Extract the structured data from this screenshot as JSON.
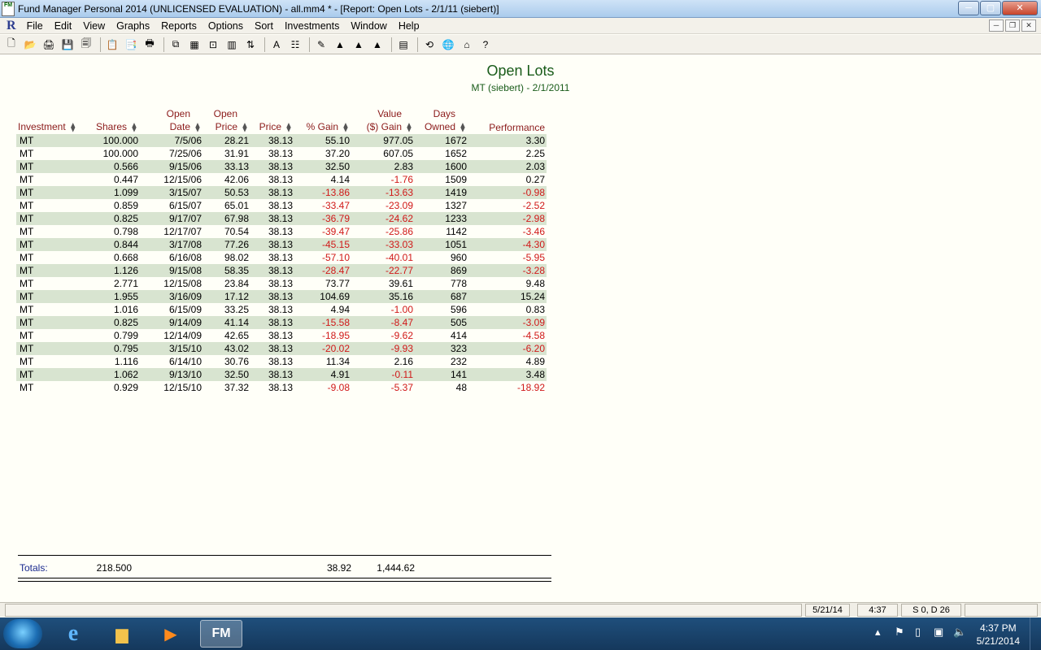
{
  "window": {
    "title": "Fund Manager Personal 2014 (UNLICENSED EVALUATION) - all.mm4 * - [Report: Open Lots - 2/1/11 (siebert)]",
    "app_icon_text": "FM",
    "minimize": "─",
    "maximize": "▢",
    "close": "✕"
  },
  "menubar": {
    "logo": "R",
    "items": [
      "File",
      "Edit",
      "View",
      "Graphs",
      "Reports",
      "Options",
      "Sort",
      "Investments",
      "Window",
      "Help"
    ],
    "mdi_min": "─",
    "mdi_restore": "❐",
    "mdi_close": "✕"
  },
  "toolbar": {
    "buttons": [
      {
        "name": "new-icon",
        "glyph": "🗋"
      },
      {
        "name": "open-icon",
        "glyph": "📂"
      },
      {
        "name": "print-setup-icon",
        "glyph": "🖨"
      },
      {
        "name": "save-icon",
        "glyph": "💾"
      },
      {
        "name": "save-all-icon",
        "glyph": "🗐"
      },
      {
        "name": "import-icon",
        "glyph": "📋"
      },
      {
        "name": "export-icon",
        "glyph": "📑"
      },
      {
        "name": "print-icon",
        "glyph": "🖶"
      },
      {
        "name": "copy-icon",
        "glyph": "⧉"
      },
      {
        "name": "report-icon",
        "glyph": "▦"
      },
      {
        "name": "zoom-icon",
        "glyph": "⊡"
      },
      {
        "name": "columns-icon",
        "glyph": "▥"
      },
      {
        "name": "sort-icon",
        "glyph": "⇅"
      },
      {
        "name": "font-icon",
        "glyph": "A"
      },
      {
        "name": "select-columns-icon",
        "glyph": "☷"
      },
      {
        "name": "edit-icon",
        "glyph": "✎"
      },
      {
        "name": "prices-icon",
        "glyph": "▲"
      },
      {
        "name": "history-icon",
        "glyph": "▲"
      },
      {
        "name": "transactions-icon",
        "glyph": "▲"
      },
      {
        "name": "calculator-icon",
        "glyph": "▤"
      },
      {
        "name": "refresh-icon",
        "glyph": "⟲"
      },
      {
        "name": "web-icon",
        "glyph": "🌐"
      },
      {
        "name": "home-icon",
        "glyph": "⌂"
      },
      {
        "name": "help-icon",
        "glyph": "?"
      }
    ]
  },
  "report": {
    "title": "Open Lots",
    "subtitle": "MT (siebert) - 2/1/2011",
    "sorter_glyph": "⧫",
    "columns": [
      {
        "line1": "",
        "line2": "Investment"
      },
      {
        "line1": "",
        "line2": "Shares"
      },
      {
        "line1": "Open",
        "line2": "Date"
      },
      {
        "line1": "Open",
        "line2": "Price"
      },
      {
        "line1": "",
        "line2": "Price"
      },
      {
        "line1": "",
        "line2": "% Gain"
      },
      {
        "line1": "Value",
        "line2": "($) Gain"
      },
      {
        "line1": "Days",
        "line2": "Owned"
      },
      {
        "line1": "",
        "line2": "Performance"
      }
    ],
    "rows": [
      [
        "MT",
        "100.000",
        "7/5/06",
        "28.21",
        "38.13",
        "55.10",
        "977.05",
        "1672",
        "3.30"
      ],
      [
        "MT",
        "100.000",
        "7/25/06",
        "31.91",
        "38.13",
        "37.20",
        "607.05",
        "1652",
        "2.25"
      ],
      [
        "MT",
        "0.566",
        "9/15/06",
        "33.13",
        "38.13",
        "32.50",
        "2.83",
        "1600",
        "2.03"
      ],
      [
        "MT",
        "0.447",
        "12/15/06",
        "42.06",
        "38.13",
        "4.14",
        "-1.76",
        "1509",
        "0.27"
      ],
      [
        "MT",
        "1.099",
        "3/15/07",
        "50.53",
        "38.13",
        "-13.86",
        "-13.63",
        "1419",
        "-0.98"
      ],
      [
        "MT",
        "0.859",
        "6/15/07",
        "65.01",
        "38.13",
        "-33.47",
        "-23.09",
        "1327",
        "-2.52"
      ],
      [
        "MT",
        "0.825",
        "9/17/07",
        "67.98",
        "38.13",
        "-36.79",
        "-24.62",
        "1233",
        "-2.98"
      ],
      [
        "MT",
        "0.798",
        "12/17/07",
        "70.54",
        "38.13",
        "-39.47",
        "-25.86",
        "1142",
        "-3.46"
      ],
      [
        "MT",
        "0.844",
        "3/17/08",
        "77.26",
        "38.13",
        "-45.15",
        "-33.03",
        "1051",
        "-4.30"
      ],
      [
        "MT",
        "0.668",
        "6/16/08",
        "98.02",
        "38.13",
        "-57.10",
        "-40.01",
        "960",
        "-5.95"
      ],
      [
        "MT",
        "1.126",
        "9/15/08",
        "58.35",
        "38.13",
        "-28.47",
        "-22.77",
        "869",
        "-3.28"
      ],
      [
        "MT",
        "2.771",
        "12/15/08",
        "23.84",
        "38.13",
        "73.77",
        "39.61",
        "778",
        "9.48"
      ],
      [
        "MT",
        "1.955",
        "3/16/09",
        "17.12",
        "38.13",
        "104.69",
        "35.16",
        "687",
        "15.24"
      ],
      [
        "MT",
        "1.016",
        "6/15/09",
        "33.25",
        "38.13",
        "4.94",
        "-1.00",
        "596",
        "0.83"
      ],
      [
        "MT",
        "0.825",
        "9/14/09",
        "41.14",
        "38.13",
        "-15.58",
        "-8.47",
        "505",
        "-3.09"
      ],
      [
        "MT",
        "0.799",
        "12/14/09",
        "42.65",
        "38.13",
        "-18.95",
        "-9.62",
        "414",
        "-4.58"
      ],
      [
        "MT",
        "0.795",
        "3/15/10",
        "43.02",
        "38.13",
        "-20.02",
        "-9.93",
        "323",
        "-6.20"
      ],
      [
        "MT",
        "1.116",
        "6/14/10",
        "30.76",
        "38.13",
        "11.34",
        "2.16",
        "232",
        "4.89"
      ],
      [
        "MT",
        "1.062",
        "9/13/10",
        "32.50",
        "38.13",
        "4.91",
        "-0.11",
        "141",
        "3.48"
      ],
      [
        "MT",
        "0.929",
        "12/15/10",
        "37.32",
        "38.13",
        "-9.08",
        "-5.37",
        "48",
        "-18.92"
      ]
    ],
    "totals": {
      "label": "Totals:",
      "shares": "218.500",
      "pct_gain": "38.92",
      "value_gain": "1,444.62"
    },
    "negative_color": "#d01818",
    "header_color": "#8b1a1a",
    "band_color": "#d8e4d0"
  },
  "statusbar": {
    "date": "5/21/14",
    "time": "4:37",
    "counts": "S 0, D 26"
  },
  "taskbar": {
    "clock_time": "4:37 PM",
    "clock_date": "5/21/2014",
    "apps": [
      {
        "name": "ie-icon",
        "glyph": "e"
      },
      {
        "name": "explorer-icon",
        "glyph": "▆"
      },
      {
        "name": "media-player-icon",
        "glyph": "▶"
      },
      {
        "name": "fund-manager-icon",
        "glyph": "FM"
      }
    ]
  }
}
